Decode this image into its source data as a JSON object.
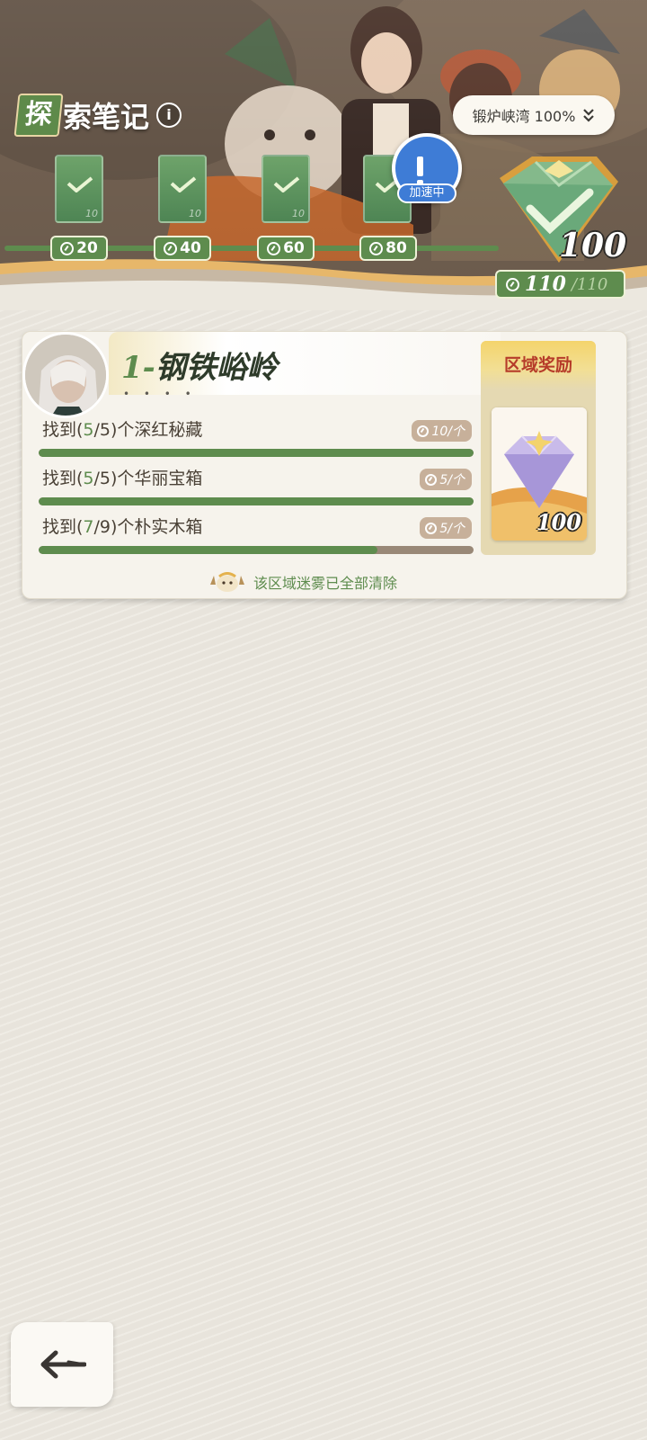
{
  "header": {
    "title_first_char": "探",
    "title_rest": "索笔记",
    "info_glyph": "i",
    "region_selector": {
      "label": "锻炉峡湾 100%"
    },
    "milestones": [
      {
        "points": "20",
        "card_num": "10",
        "claimed": true
      },
      {
        "points": "40",
        "card_num": "10",
        "claimed": true
      },
      {
        "points": "60",
        "card_num": "10",
        "claimed": true
      },
      {
        "points": "80",
        "card_num": "",
        "claimed": true
      }
    ],
    "speed_button": {
      "label": "加速中"
    },
    "final_reward": {
      "count": "100",
      "current": "110",
      "max": "/110"
    }
  },
  "region_card": {
    "index": "1",
    "separator": "-",
    "name": "钢铁峪岭",
    "dots": "• • • •",
    "tasks": [
      {
        "prefix": "找到(",
        "found": "5",
        "total": "/5)",
        "suffix": "个深红秘藏",
        "reward": "10/个",
        "progress": 1.0
      },
      {
        "prefix": "找到(",
        "found": "5",
        "total": "/5)",
        "suffix": "个华丽宝箱",
        "reward": "5/个",
        "progress": 1.0
      },
      {
        "prefix": "找到(",
        "found": "7",
        "total": "/9)",
        "suffix": "个朴实木箱",
        "reward": "5/个",
        "progress": 0.778
      }
    ],
    "clear_note": "该区域迷雾已全部清除",
    "reward_panel": {
      "title": "区域奖励",
      "count": "100"
    }
  },
  "colors": {
    "accent_green": "#5e8c4e",
    "reward_red": "#b63c2a",
    "speed_blue": "#3e7cd6"
  },
  "icons": {
    "back": "back-arrow-icon",
    "pause": "pause-icon",
    "clock": "clock-icon",
    "check": "check-icon",
    "gem": "gem-icon"
  }
}
